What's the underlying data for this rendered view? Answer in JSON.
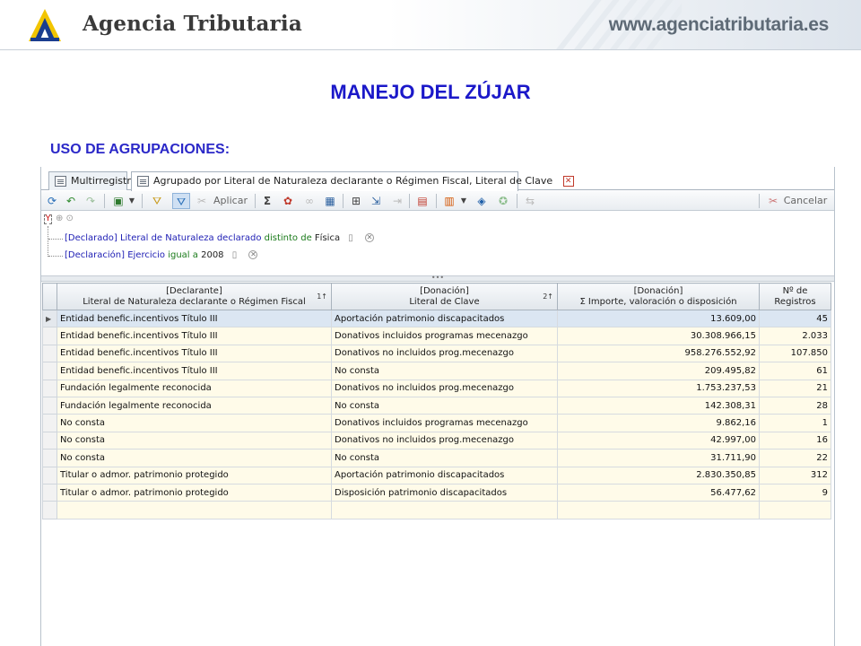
{
  "banner": {
    "brand": "Agencia Tributaria",
    "url": "www.agenciatributaria.es",
    "colors": {
      "logo_yellow": "#f2c500",
      "logo_blue": "#1a3d8f",
      "title_blue": "#1b18c9"
    }
  },
  "slide": {
    "title": "MANEJO DEL ZÚJAR",
    "subtitle": "USO DE AGRUPACIONES:"
  },
  "tabs": [
    {
      "label": "Multirregistro",
      "icon": "list-icon"
    },
    {
      "label": "Agrupado por Literal de Naturaleza declarante o Régimen Fiscal, Literal de Clave",
      "icon": "grid-icon",
      "active": true
    }
  ],
  "toolbar": {
    "apply_label": "Aplicar",
    "cancel_label": "Cancelar",
    "icons": [
      "refresh-icon",
      "undo-icon",
      "redo-icon",
      "save-icon",
      "filter-icon",
      "filter-active-icon",
      "apply-icon",
      "sum-icon",
      "chart-colors-icon",
      "link-icon",
      "table-icon",
      "columns-icon",
      "export-icon",
      "move-icon",
      "print-icon",
      "bar-chart-icon",
      "cube-icon",
      "settings-icon",
      "navigate-icon",
      "cancel-icon"
    ]
  },
  "filters": [
    {
      "field": "[Declarado] Literal de Naturaleza declarado",
      "operator": "distinto de",
      "value": "Física"
    },
    {
      "field": "[Declaración] Ejercicio",
      "operator": "igual a",
      "value": "2008"
    }
  ],
  "grid": {
    "headers": [
      {
        "line1": "[Declarante]",
        "line2": "Literal de Naturaleza declarante o Régimen Fiscal",
        "sort": "1↑"
      },
      {
        "line1": "[Donación]",
        "line2": "Literal de Clave",
        "sort": "2↑"
      },
      {
        "line1": "[Donación]",
        "line2": "Σ Importe, valoración o disposición",
        "sort": ""
      },
      {
        "line1": "Nº de",
        "line2": "Registros",
        "sort": ""
      }
    ],
    "rows": [
      [
        "Entidad benefic.incentivos Título III",
        "Aportación patrimonio discapacitados",
        "13.609,00",
        "45"
      ],
      [
        "Entidad benefic.incentivos Título III",
        "Donativos incluidos programas mecenazgo",
        "30.308.966,15",
        "2.033"
      ],
      [
        "Entidad benefic.incentivos Título III",
        "Donativos no incluidos prog.mecenazgo",
        "958.276.552,92",
        "107.850"
      ],
      [
        "Entidad benefic.incentivos Título III",
        "No consta",
        "209.495,82",
        "61"
      ],
      [
        "Fundación legalmente reconocida",
        "Donativos no incluidos prog.mecenazgo",
        "1.753.237,53",
        "21"
      ],
      [
        "Fundación legalmente reconocida",
        "No consta",
        "142.308,31",
        "28"
      ],
      [
        "No consta",
        "Donativos incluidos programas mecenazgo",
        "9.862,16",
        "1"
      ],
      [
        "No consta",
        "Donativos no incluidos prog.mecenazgo",
        "42.997,00",
        "16"
      ],
      [
        "No consta",
        "No consta",
        "31.711,90",
        "22"
      ],
      [
        "Titular o admor. patrimonio protegido",
        "Aportación patrimonio discapacitados",
        "2.830.350,85",
        "312"
      ],
      [
        "Titular o admor. patrimonio protegido",
        "Disposición patrimonio discapacitados",
        "56.477,62",
        "9"
      ]
    ],
    "empty_rows": 1
  }
}
